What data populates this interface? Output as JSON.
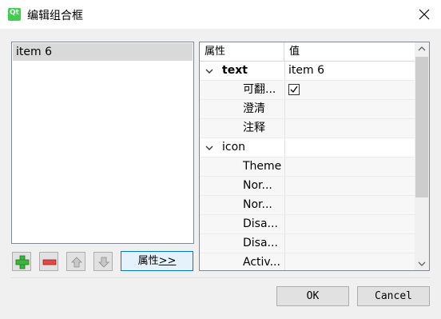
{
  "window": {
    "title": "编辑组合框",
    "app_icon": "qt-icon"
  },
  "list": {
    "items": [
      {
        "label": "item 6",
        "selected": true
      }
    ]
  },
  "toolbar": {
    "add_icon": "plus-icon",
    "remove_icon": "minus-icon",
    "up_icon": "arrow-up-icon",
    "down_icon": "arrow-down-icon",
    "properties_label": "属性>>",
    "properties_mnemonic_label": "属性",
    "properties_suffix": ">>"
  },
  "property_editor": {
    "headers": {
      "property": "属性",
      "value": "值"
    },
    "rows": [
      {
        "label": "text",
        "value": "item 6",
        "expanded": true,
        "bold": true,
        "level": 0
      },
      {
        "label": "可翻...",
        "value": "",
        "checkbox": true,
        "checked": true,
        "level": 1
      },
      {
        "label": "澄清",
        "value": "",
        "level": 1
      },
      {
        "label": "注释",
        "value": "",
        "level": 1
      },
      {
        "label": "icon",
        "value": "",
        "expanded": true,
        "level": 0
      },
      {
        "label": "Theme",
        "value": "",
        "level": 1
      },
      {
        "label": "Nor...",
        "value": "",
        "level": 1
      },
      {
        "label": "Nor...",
        "value": "",
        "level": 1
      },
      {
        "label": "Disa...",
        "value": "",
        "level": 1
      },
      {
        "label": "Disa...",
        "value": "",
        "level": 1
      },
      {
        "label": "Activ...",
        "value": "",
        "level": 1
      }
    ]
  },
  "buttons": {
    "ok": "OK",
    "cancel": "Cancel"
  },
  "colors": {
    "accent": "#0078d7",
    "qt_green": "#41cd52",
    "add_green": "#3cb43c",
    "remove_red": "#e04848"
  }
}
